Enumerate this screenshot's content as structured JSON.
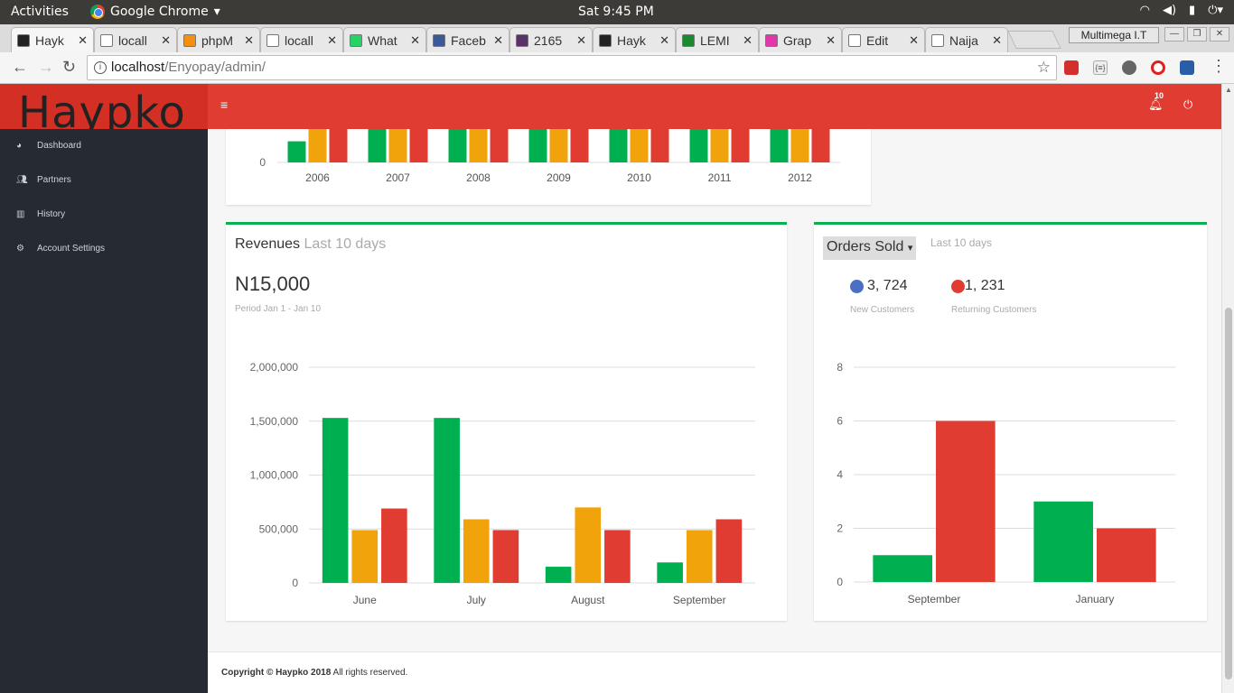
{
  "os": {
    "activities": "Activities",
    "app_name": "Google Chrome",
    "app_menu_arrow": "▾",
    "clock": "Sat  9:45 PM",
    "tray": [
      "wifi-icon",
      "volume-icon",
      "battery-icon",
      "power-menu-icon"
    ]
  },
  "browser": {
    "tabs": [
      {
        "label": "Hayk",
        "icon": "map-pin-icon",
        "active": true
      },
      {
        "label": "locall",
        "icon": "page-icon"
      },
      {
        "label": "phpM",
        "icon": "pma-icon"
      },
      {
        "label": "locall",
        "icon": "page-icon"
      },
      {
        "label": "What",
        "icon": "whatsapp-icon"
      },
      {
        "label": "Faceb",
        "icon": "facebook-icon"
      },
      {
        "label": "2165",
        "icon": "tor-icon"
      },
      {
        "label": "Hayk",
        "icon": "map-pin-icon"
      },
      {
        "label": "LEMI",
        "icon": "star-icon"
      },
      {
        "label": "Grap",
        "icon": "graphql-icon"
      },
      {
        "label": "Edit",
        "icon": "page-icon"
      },
      {
        "label": "Naija",
        "icon": "page-icon"
      }
    ],
    "profile": "Multimega I.T",
    "url_host": "localhost",
    "url_path": "/Enyopay/admin/"
  },
  "app": {
    "logo": "Haypko",
    "notification_count": "10",
    "sidebar": [
      {
        "label": "Dashboard",
        "icon": "dashboard-icon"
      },
      {
        "label": "Partners",
        "icon": "users-icon"
      },
      {
        "label": "History",
        "icon": "bar-chart-icon"
      },
      {
        "label": "Account Settings",
        "icon": "gear-icon"
      }
    ],
    "revenues": {
      "title": "Revenues",
      "subtitle": "Last 10 days",
      "amount": "N15,000",
      "period": "Period Jan 1 - Jan 10"
    },
    "orders": {
      "dropdown": "Orders Sold",
      "dropdown_arrow": "▾",
      "subtitle": "Last 10 days",
      "new_value": "3, 724",
      "new_label": "New Customers",
      "returning_value": "1, 231",
      "returning_label": "Returning Customers"
    },
    "footer_bold": "Copyright © Haypko 2018",
    "footer_rest": " All rights reserved."
  },
  "colors": {
    "green": "#00b050",
    "orange": "#f0a30a",
    "red": "#e03c31",
    "blue": "#4a6fc3",
    "header": "#e03c31"
  },
  "chart_data": [
    {
      "type": "bar",
      "title": "",
      "categories": [
        "2006",
        "2007",
        "2008",
        "2009",
        "2010",
        "2011",
        "2012"
      ],
      "y_ticks": [
        "0"
      ],
      "note": "partially visible (scrolled)",
      "series": [
        {
          "color": "#00b050",
          "values": [
            0.9,
            null,
            null,
            null,
            null,
            null,
            null
          ]
        },
        {
          "color": "#f0a30a",
          "values": [
            null,
            null,
            null,
            null,
            null,
            null,
            null
          ]
        },
        {
          "color": "#e03c31",
          "values": [
            null,
            null,
            null,
            null,
            null,
            null,
            null
          ]
        }
      ]
    },
    {
      "type": "bar",
      "title": "Revenues",
      "categories": [
        "June",
        "July",
        "August",
        "September"
      ],
      "ylim": [
        0,
        2000000
      ],
      "y_ticks": [
        "0",
        "500,000",
        "1,000,000",
        "1,500,000",
        "2,000,000"
      ],
      "y_tick_values": [
        0,
        500000,
        1000000,
        1500000,
        2000000
      ],
      "series": [
        {
          "color": "#00b050",
          "values": [
            1530000,
            1530000,
            150000,
            190000
          ]
        },
        {
          "color": "#f0a30a",
          "values": [
            490000,
            590000,
            700000,
            490000
          ]
        },
        {
          "color": "#e03c31",
          "values": [
            690000,
            490000,
            490000,
            590000
          ]
        }
      ]
    },
    {
      "type": "bar",
      "title": "Orders Sold",
      "categories": [
        "September",
        "January"
      ],
      "ylim": [
        0,
        8
      ],
      "y_ticks": [
        "0",
        "2",
        "4",
        "6",
        "8"
      ],
      "y_tick_values": [
        0,
        2,
        4,
        6,
        8
      ],
      "series": [
        {
          "color": "#00b050",
          "values": [
            1,
            3
          ]
        },
        {
          "color": "#e03c31",
          "values": [
            6,
            2
          ]
        }
      ]
    }
  ]
}
